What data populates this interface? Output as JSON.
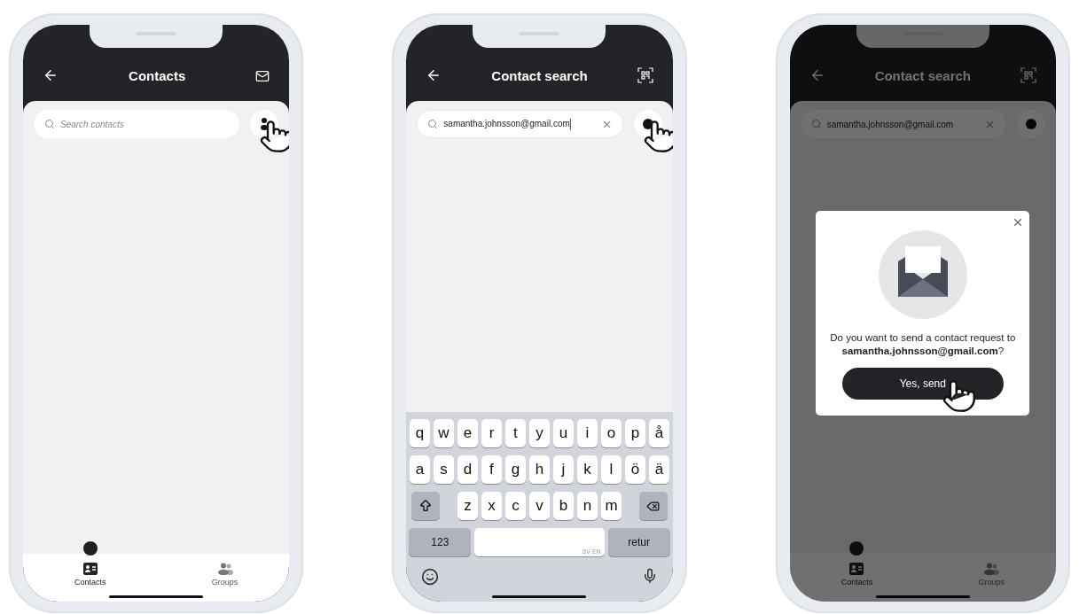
{
  "phones": [
    {
      "header": {
        "title": "Contacts",
        "action": {
          "kind": "mail"
        }
      },
      "search": {
        "placeholder": "Search contacts"
      },
      "add_button": {
        "kind": "person",
        "tapped": true
      },
      "tabs": [
        {
          "label": "Contacts",
          "selected": true
        },
        {
          "label": "Groups",
          "selected": false
        }
      ]
    },
    {
      "header": {
        "title": "Contact search",
        "action": {
          "kind": "qr"
        }
      },
      "search": {
        "value": "samantha.johnsson@gmail.com",
        "focused": true
      },
      "add_button": {
        "kind": "dot",
        "tapped": true
      },
      "keyboard": {
        "rows": [
          [
            "q",
            "w",
            "e",
            "r",
            "t",
            "y",
            "u",
            "i",
            "o",
            "p",
            "å"
          ],
          [
            "a",
            "s",
            "d",
            "f",
            "g",
            "h",
            "j",
            "k",
            "l",
            "ö",
            "ä"
          ]
        ],
        "bottom_letters": [
          "z",
          "x",
          "c",
          "v",
          "b",
          "n",
          "m"
        ],
        "number_key": "123",
        "space_hint": "SV EN",
        "return_key": "retur"
      }
    },
    {
      "header": {
        "title": "Contact search",
        "action": {
          "kind": "qr"
        }
      },
      "search": {
        "value": "samantha.johnsson@gmail.com",
        "focused": false
      },
      "add_button": {
        "kind": "dot",
        "tapped": false
      },
      "tabs": [
        {
          "label": "Contacts",
          "selected": true
        },
        {
          "label": "Groups",
          "selected": false
        }
      ],
      "dialog": {
        "message": "Do you want to send a contact request to **samantha.johnsson@gmail.com**?",
        "confirm": {
          "label": "Yes, send",
          "tapped": true
        }
      }
    }
  ]
}
